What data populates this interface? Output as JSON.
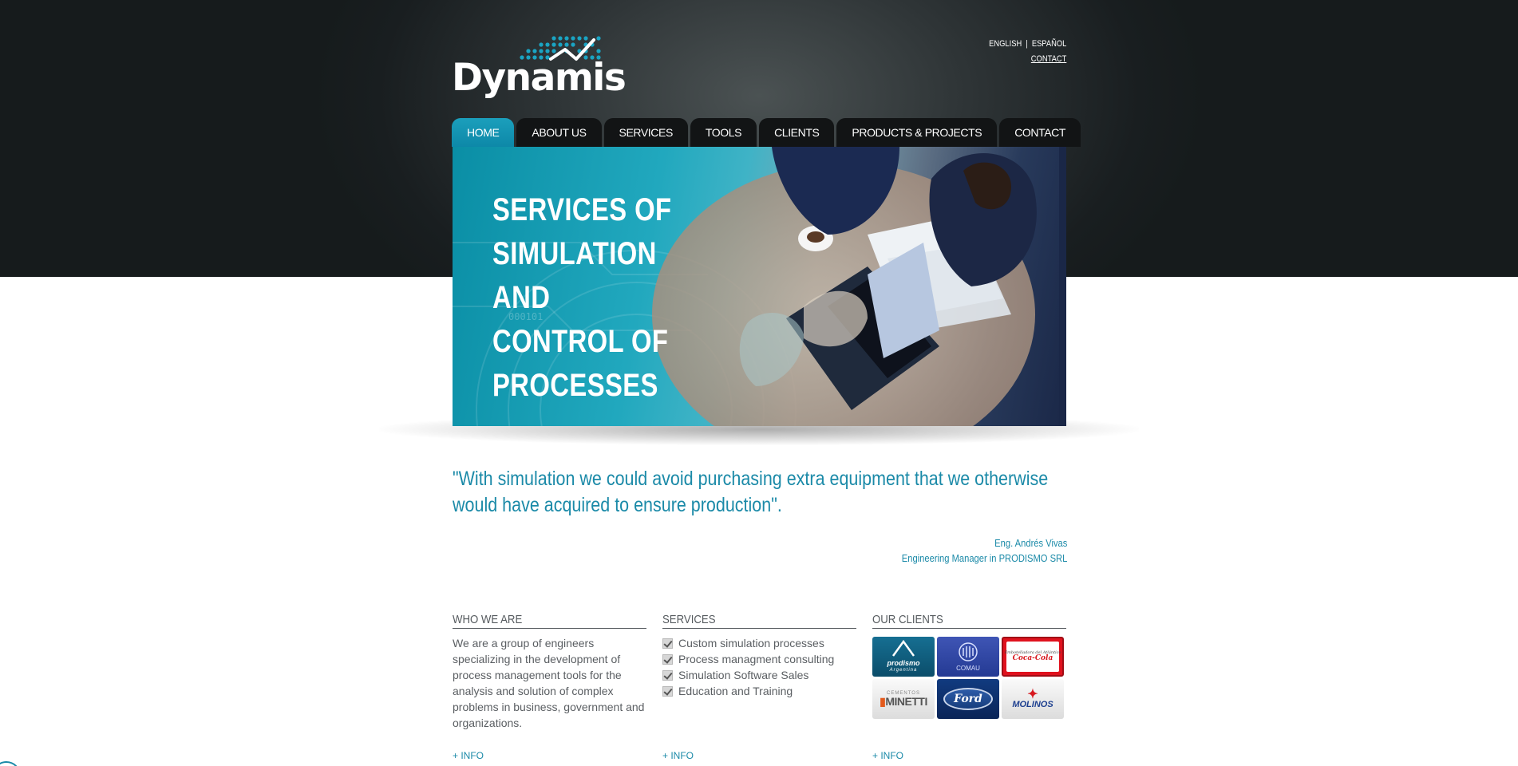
{
  "header": {
    "logo_text": "Dynamis",
    "lang_english": "ENGLISH",
    "lang_separator": "|",
    "lang_espanol": "ESPAÑOL",
    "contact_link": "CONTACT"
  },
  "nav": {
    "items": [
      {
        "label": "HOME",
        "active": true
      },
      {
        "label": "ABOUT US"
      },
      {
        "label": "SERVICES"
      },
      {
        "label": "TOOLS"
      },
      {
        "label": "CLIENTS"
      },
      {
        "label": "PRODUCTS & PROJECTS"
      },
      {
        "label": "CONTACT"
      }
    ]
  },
  "banner": {
    "title_lines": [
      "SERVICES OF",
      "SIMULATION AND",
      "CONTROL OF",
      "PROCESSES"
    ],
    "overlay_text": "000101"
  },
  "quote": {
    "text": "\"With simulation we could avoid purchasing extra equipment that we otherwise would have acquired to ensure production\".",
    "author": "Eng. Andrés Vivas",
    "author_title": "Engineering Manager in PRODISMO SRL"
  },
  "who_we_are": {
    "heading": "WHO WE ARE",
    "text": "We are a group of engineers specializing in the development of process management tools for the analysis and solution of complex problems in business, government and organizations.",
    "more": "+ INFO"
  },
  "services": {
    "heading": "SERVICES",
    "items": [
      "Custom simulation processes",
      "Process managment consulting",
      "Simulation Software Sales",
      "Education and Training"
    ],
    "more": "+ INFO"
  },
  "clients": {
    "heading": "OUR CLIENTS",
    "logos": [
      {
        "name": "prodismo",
        "sub": "Argentina",
        "bg": "#0f5f80"
      },
      {
        "name": "COMAU",
        "bg": "#2a3f9e"
      },
      {
        "name": "Coca-Cola",
        "sub": "Embotelladora del Atlántico",
        "bg": "#e0121e"
      },
      {
        "name": "MINETTI",
        "sub": "CEMENTOS",
        "bg": "#f2f2f2"
      },
      {
        "name": "Ford",
        "bg": "#0b2f6b"
      },
      {
        "name": "MOLINOS",
        "bg": "#f2f2f2"
      }
    ],
    "more": "+ INFO"
  },
  "colors": {
    "accent": "#1b8aa8",
    "header_dark": "#191e20",
    "nav_tab": "#121415",
    "nav_active": "#1b9fbc",
    "body_text": "#5a5e62"
  }
}
